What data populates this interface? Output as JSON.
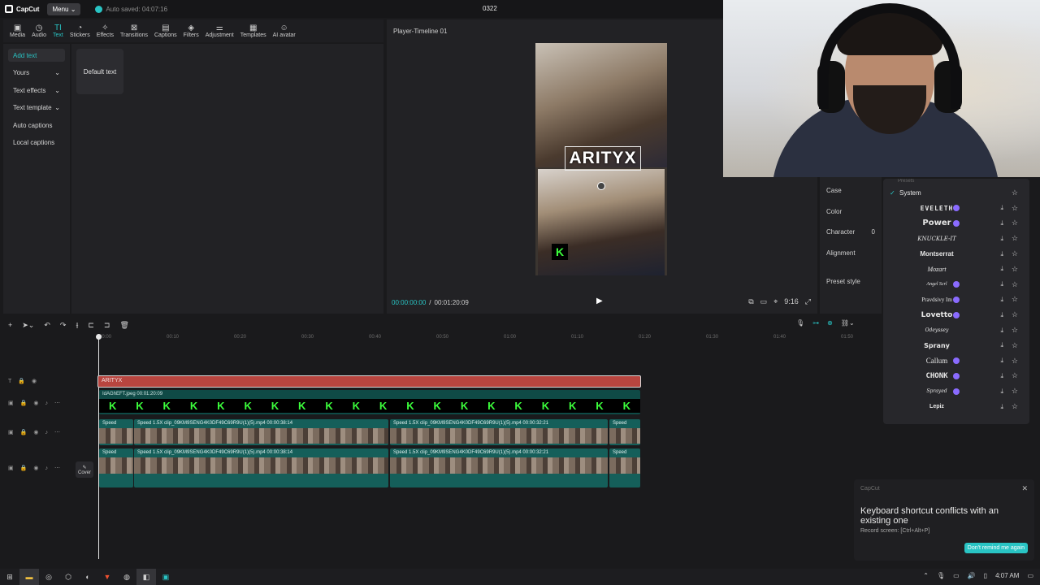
{
  "app": {
    "logo_text": "CapCut",
    "menu_label": "Menu",
    "autosave": "Auto saved: 04:07:16",
    "project_title": "0322",
    "accent": "#29c4c4"
  },
  "toolbar": {
    "items": [
      {
        "label": "Media",
        "icon": "media-icon"
      },
      {
        "label": "Audio",
        "icon": "audio-icon"
      },
      {
        "label": "Text",
        "icon": "text-icon"
      },
      {
        "label": "Stickers",
        "icon": "stickers-icon"
      },
      {
        "label": "Effects",
        "icon": "effects-icon"
      },
      {
        "label": "Transitions",
        "icon": "transitions-icon"
      },
      {
        "label": "Captions",
        "icon": "captions-icon"
      },
      {
        "label": "Filters",
        "icon": "filters-icon"
      },
      {
        "label": "Adjustment",
        "icon": "adjustment-icon"
      },
      {
        "label": "Templates",
        "icon": "templates-icon"
      },
      {
        "label": "AI avatar",
        "icon": "ai-avatar-icon"
      }
    ]
  },
  "leftnav": {
    "items": [
      "Add text",
      "Yours",
      "Text effects",
      "Text template",
      "Auto captions",
      "Local captions"
    ]
  },
  "library": {
    "default_card": "Default text"
  },
  "player": {
    "title": "Player-Timeline 01",
    "overlay_text": "ARITYX",
    "current_time": "00:00:00:00",
    "total_time": "00:01:20:09",
    "badge_letter": "K",
    "tools_right": [
      "9:16"
    ]
  },
  "properties": {
    "rows": [
      "Case",
      "Color",
      "Character",
      "Alignment",
      "Preset style"
    ],
    "character_value": "0"
  },
  "fontlist": {
    "presets_label": "Presets",
    "fonts": [
      {
        "name": "System",
        "selected": true,
        "pro": false
      },
      {
        "name": "EVELETH",
        "selected": false,
        "pro": true
      },
      {
        "name": "Power",
        "selected": false,
        "pro": true
      },
      {
        "name": "KNUCKLE-IT",
        "selected": false,
        "pro": false
      },
      {
        "name": "Montserrat",
        "selected": false,
        "pro": false
      },
      {
        "name": "Mozart",
        "selected": false,
        "pro": false
      },
      {
        "name": "Angel Scrl",
        "selected": false,
        "pro": true
      },
      {
        "name": "Pravdsivy Im",
        "selected": false,
        "pro": true
      },
      {
        "name": "Lovetto",
        "selected": false,
        "pro": true
      },
      {
        "name": "Odeyssey",
        "selected": false,
        "pro": false
      },
      {
        "name": "Sprany",
        "selected": false,
        "pro": false
      },
      {
        "name": "Callum",
        "selected": false,
        "pro": true
      },
      {
        "name": "CHONK",
        "selected": false,
        "pro": true
      },
      {
        "name": "Sprayed",
        "selected": false,
        "pro": true
      },
      {
        "name": "Lepiz",
        "selected": false,
        "pro": false
      }
    ]
  },
  "timeline": {
    "ruler_ticks": [
      "00:00",
      "00:10",
      "00:20",
      "00:30",
      "00:40",
      "00:50",
      "01:00",
      "01:10",
      "01:20",
      "01:30",
      "01:40",
      "01:50"
    ],
    "text_clip": "ARITYX",
    "overlay_clip": "IdAGhEFT.jpeg   00:01:20:09",
    "video_row1": [
      {
        "caption": "Speed"
      },
      {
        "caption": "Speed 1.5X   clip_09KM9SENG4K0DF49C69R9U(1)(5).mp4   00:00:38:14"
      },
      {
        "caption": "Speed 1.5X   clip_09KM9SENG4K0DF49C69R9U(1)(5).mp4   00:00:32:21"
      },
      {
        "caption": "Speed"
      }
    ],
    "video_row2": [
      {
        "caption": "Speed"
      },
      {
        "caption": "Speed 1.5X   clip_09KM9SENG4K0DF49C69R9U(1)(5).mp4   00:00:38:14"
      },
      {
        "caption": "Speed 1.5X   clip_09KM9SENG4K0DF49C69R9U(1)(5).mp4   00:00:32:21"
      },
      {
        "caption": "Speed"
      }
    ],
    "cover_label": "Cover"
  },
  "toast": {
    "app": "CapCut",
    "message": "Keyboard shortcut conflicts with an existing one",
    "sub": "Record screen: [Ctrl+Alt+P]",
    "button": "Don't remind me again"
  },
  "taskbar": {
    "time": "4:07 AM"
  }
}
